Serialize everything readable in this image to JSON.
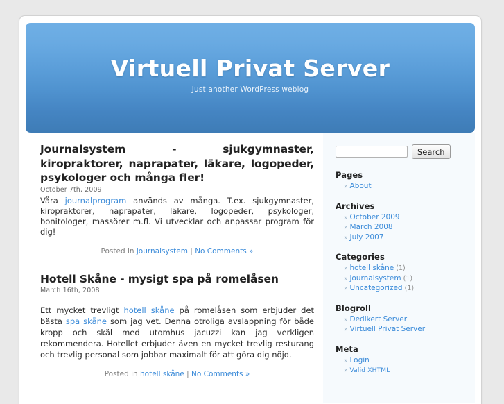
{
  "site": {
    "title": "Virtuell Privat Server",
    "description": "Just another WordPress weblog"
  },
  "colors": {
    "page_background": "#e9e9e9",
    "content_background": "#ffffff",
    "sidebar_background": "#f6fafd",
    "header_gradient_top": "#6fafe5",
    "header_gradient_bottom": "#3e7cb6",
    "link": "#3b8bd9",
    "muted_text": "#808080"
  },
  "posts": [
    {
      "title": "Journalsystem - sjukgymnaster, kiropraktorer, naprapater, läkare, logopeder, psykologer och många fler!",
      "date": "October 7th, 2009",
      "body_lead": "Våra ",
      "body_link": "journalprogram",
      "body_rest": " används av många. T.ex. sjukgymnaster, kiropraktorer, naprapater, läkare, logopeder, psykologer, bonitologer, massörer m.fl. Vi utvecklar och anpassar program för dig!",
      "posted_in_label": "Posted in ",
      "category": "journalsystem",
      "separator": " | ",
      "comments": "No Comments »"
    },
    {
      "title": "Hotell Skåne - mysigt spa på romelåsen",
      "date": "March 16th, 2008",
      "body_lead": "Ett mycket trevligt ",
      "body_link": "hotell skåne",
      "body_mid": " på romelåsen som erbjuder det bästa ",
      "body_link2": "spa skåne",
      "body_rest": " som jag vet. Denna otroliga avslappning för både kropp och skäl med utomhus jacuzzi kan jag verkligen rekommendera.  Hotellet erbjuder även en mycket trevlig resturang och trevlig personal som jobbar maximalt för att göra dig nöjd.",
      "posted_in_label": "Posted in ",
      "category": "hotell skåne",
      "separator": " | ",
      "comments": "No Comments »"
    }
  ],
  "sidebar": {
    "search": {
      "value": "",
      "placeholder": "",
      "button_label": "Search"
    },
    "blocks": [
      {
        "heading": "Pages",
        "items": [
          {
            "label": "About",
            "count": ""
          }
        ]
      },
      {
        "heading": "Archives",
        "items": [
          {
            "label": "October 2009",
            "count": ""
          },
          {
            "label": "March 2008",
            "count": ""
          },
          {
            "label": "July 2007",
            "count": ""
          }
        ]
      },
      {
        "heading": "Categories",
        "items": [
          {
            "label": "hotell skåne",
            "count": "(1)"
          },
          {
            "label": "journalsystem",
            "count": "(1)"
          },
          {
            "label": "Uncategorized",
            "count": "(1)"
          }
        ]
      },
      {
        "heading": "Blogroll",
        "items": [
          {
            "label": "Dedikert Server",
            "count": ""
          },
          {
            "label": "Virtuell Privat Server",
            "count": ""
          }
        ]
      },
      {
        "heading": "Meta",
        "items": [
          {
            "label": "Login",
            "count": ""
          },
          {
            "label": "Valid XHTML",
            "count": ""
          }
        ]
      }
    ],
    "bullet_glyph": "»"
  }
}
